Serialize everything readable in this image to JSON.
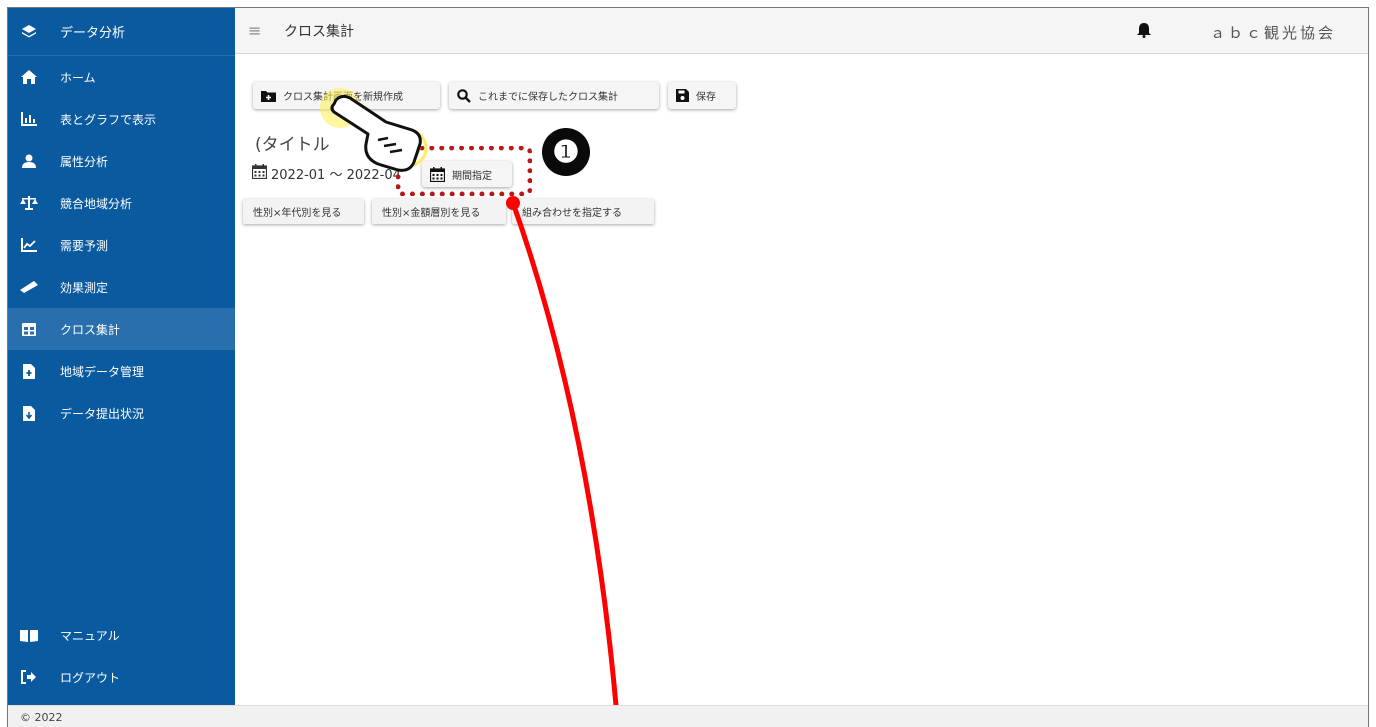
{
  "app": {
    "brand": "データ分析",
    "copyright": "© 2022"
  },
  "sidebar": {
    "items": [
      {
        "label": "ホーム",
        "icon": "home-icon"
      },
      {
        "label": "表とグラフで表示",
        "icon": "bar-chart-icon"
      },
      {
        "label": "属性分析",
        "icon": "user-icon"
      },
      {
        "label": "競合地域分析",
        "icon": "balance-scale-icon"
      },
      {
        "label": "需要予測",
        "icon": "line-chart-icon"
      },
      {
        "label": "効果測定",
        "icon": "ruler-icon"
      },
      {
        "label": "クロス集計",
        "icon": "table-icon",
        "active": true
      },
      {
        "label": "地域データ管理",
        "icon": "file-upload-icon"
      },
      {
        "label": "データ提出状況",
        "icon": "file-download-icon"
      }
    ],
    "bottom": [
      {
        "label": "マニュアル",
        "icon": "book-icon"
      },
      {
        "label": "ログアウト",
        "icon": "logout-icon"
      }
    ]
  },
  "header": {
    "title": "クロス集計",
    "org": "ａｂｃ観光協会"
  },
  "toolbar": {
    "new_label": "クロス集計画面を新規作成",
    "saved_label": "これまでに保存したクロス集計",
    "save_label": "保存"
  },
  "main": {
    "title_placeholder": "(タイトル",
    "date_range": "2022-01 ～ 2022-04",
    "period_button": "期間指定",
    "filters": [
      "性別×年代別を見る",
      "性別×金額層別を見る",
      "組み合わせを指定する"
    ]
  },
  "annotation": {
    "number": "❶",
    "highlight_color": "#b81818",
    "arrow_color": "#ff0000"
  }
}
